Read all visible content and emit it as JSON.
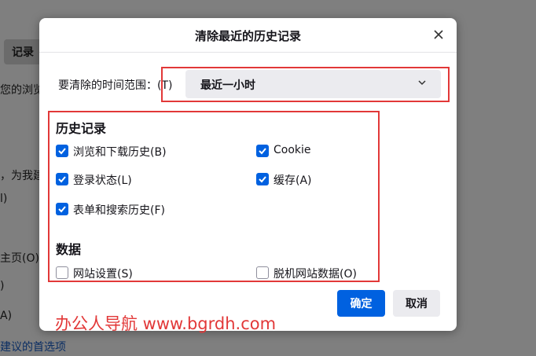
{
  "background": {
    "tab_label": "记录",
    "snippets": [
      "您的浏览",
      "，为我建",
      "l)",
      "主页(O)",
      ")",
      "A)",
      "建议的首选项"
    ]
  },
  "dialog": {
    "title": "清除最近的历史记录",
    "close_icon": "close-icon",
    "time_range_label": "要清除的时间范围：",
    "time_range_accesskey": "(T)",
    "time_range_value": "最近一小时",
    "dropdown_icon": "chevron-down-icon",
    "history_title": "历史记录",
    "history_items": [
      {
        "label": "浏览和下载历史(B)",
        "checked": true
      },
      {
        "label": "Cookie",
        "checked": true
      },
      {
        "label": "登录状态(L)",
        "checked": true
      },
      {
        "label": "缓存(A)",
        "checked": true
      },
      {
        "label": "表单和搜索历史(F)",
        "checked": true
      }
    ],
    "data_title": "数据",
    "data_items": [
      {
        "label": "网站设置(S)",
        "checked": false
      },
      {
        "label": "脱机网站数据(O)",
        "checked": false
      }
    ],
    "ok_label": "确定",
    "cancel_label": "取消"
  },
  "watermark": "办公人导航 www.bgrdh.com",
  "colors": {
    "accent": "#0061e0",
    "highlight": "#e23838"
  }
}
